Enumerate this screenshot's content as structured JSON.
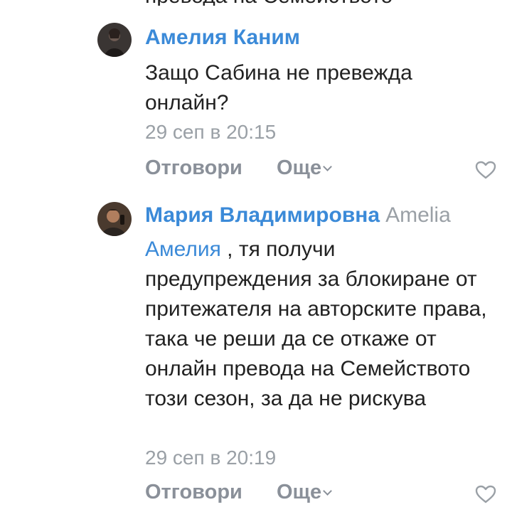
{
  "top_cut_text": "превода на Семейството",
  "comments": [
    {
      "author": "Амелия Каним",
      "reply_to": "",
      "mention": "",
      "text": "Защо Сабина не превежда онлайн?",
      "time": "29 сеп в 20:15",
      "reply_label": "Отговори",
      "more_label": "Още",
      "avatar_icon": "avatar-photo-dark",
      "like_icon": "heart-outline-icon"
    },
    {
      "author": "Мария Владимировна",
      "reply_to": "Amelia",
      "mention": "Амелия",
      "text": " , тя получи предупреждения за блокиране от притежателя на авторските права, така че реши да се откаже от онлайн превода на Семейството този сезон, за да не рискува",
      "time": "29 сеп в 20:19",
      "reply_label": "Отговори",
      "more_label": "Още",
      "avatar_icon": "avatar-photo-man",
      "like_icon": "heart-outline-icon"
    }
  ],
  "colors": {
    "author": "#3b8ad8",
    "text": "#222222",
    "meta": "#9aa0a6",
    "action": "#8a9099"
  }
}
